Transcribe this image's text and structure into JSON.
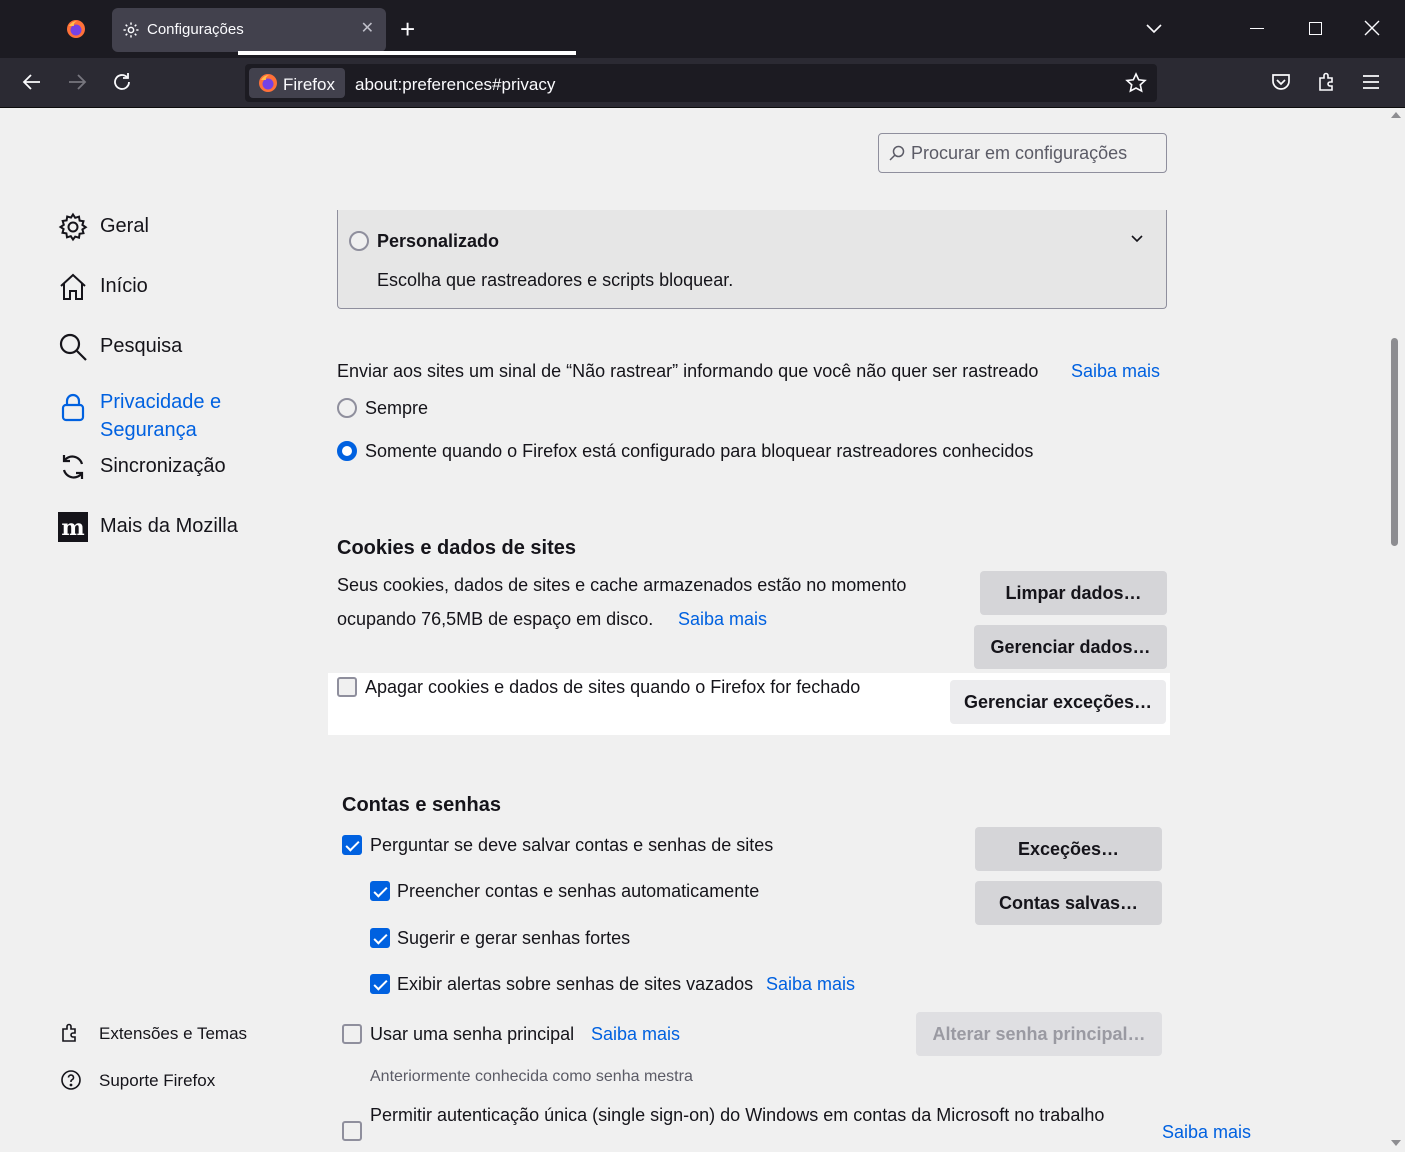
{
  "browser": {
    "tab_title": "Configurações",
    "identity_label": "Firefox",
    "url": "about:preferences#privacy"
  },
  "search": {
    "placeholder": "Procurar em configurações"
  },
  "sidebar": {
    "items": [
      {
        "label": "Geral",
        "icon": "gear-icon"
      },
      {
        "label": "Início",
        "icon": "home-icon"
      },
      {
        "label": "Pesquisa",
        "icon": "search-icon"
      },
      {
        "label": "Privacidade e Segurança",
        "icon": "lock-icon",
        "active": true
      },
      {
        "label": "Sincronização",
        "icon": "sync-icon"
      },
      {
        "label": "Mais da Mozilla",
        "icon": "mozilla-icon"
      }
    ],
    "footer": [
      {
        "label": "Extensões e Temas",
        "icon": "puzzle-icon"
      },
      {
        "label": "Suporte Firefox",
        "icon": "help-icon"
      }
    ]
  },
  "tracking": {
    "custom_title": "Personalizado",
    "custom_desc": "Escolha que rastreadores e scripts bloquear.",
    "dnt_text": "Enviar aos sites um sinal de “Não rastrear” informando que você não quer ser rastreado",
    "dnt_learn_more": "Saiba mais",
    "dnt_always": "Sempre",
    "dnt_only_when": "Somente quando o Firefox está configurado para bloquear rastreadores conhecidos"
  },
  "cookies": {
    "title": "Cookies e dados de sites",
    "desc_line1": "Seus cookies, dados de sites e cache armazenados estão no momento",
    "desc_line2": "ocupando 76,5MB de espaço em disco.",
    "learn_more": "Saiba mais",
    "clear_button": "Limpar dados…",
    "manage_button": "Gerenciar dados…",
    "delete_on_close": "Apagar cookies e dados de sites quando o Firefox for fechado",
    "exceptions_button": "Gerenciar exceções…"
  },
  "logins": {
    "title": "Contas e senhas",
    "ask_to_save": "Perguntar se deve salvar contas e senhas de sites",
    "autofill": "Preencher contas e senhas automaticamente",
    "suggest": "Sugerir e gerar senhas fortes",
    "breach_alerts": "Exibir alertas sobre senhas de sites vazados",
    "breach_learn_more": "Saiba mais",
    "exceptions_button": "Exceções…",
    "saved_button": "Contas salvas…",
    "primary_password": "Usar uma senha principal",
    "primary_learn_more": "Saiba mais",
    "primary_note": "Anteriormente conhecida como senha mestra",
    "change_primary_button": "Alterar senha principal…",
    "sso": "Permitir autenticação única (single sign-on) do Windows em contas da Microsoft no trabalho",
    "sso_learn_more": "Saiba mais"
  },
  "colors": {
    "accent": "#0061e0",
    "chrome_dark": "#1c1b22"
  }
}
